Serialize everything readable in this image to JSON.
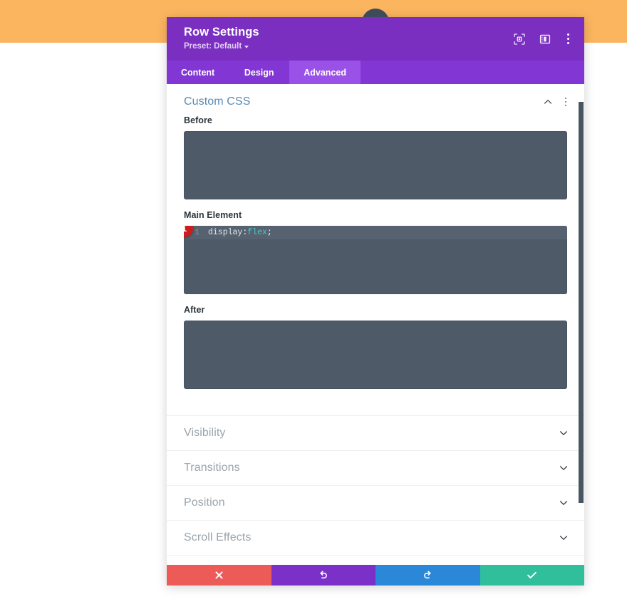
{
  "page": {
    "background_band_color": "#fbb55f",
    "background_color": "#ffffff"
  },
  "modal": {
    "title": "Row Settings",
    "preset_label": "Preset: Default",
    "header_color": "#7a2fc1",
    "tabbar_color": "#8236d4",
    "active_tab_color": "#9a51e8",
    "icons": {
      "focus": "target-focus-icon",
      "layout": "layout-panel-icon",
      "more": "kebab-menu-icon"
    },
    "tabs": [
      {
        "label": "Content",
        "active": false
      },
      {
        "label": "Design",
        "active": false
      },
      {
        "label": "Advanced",
        "active": true
      }
    ]
  },
  "custom_css": {
    "section_title": "Custom CSS",
    "expanded": true,
    "fields": [
      {
        "label": "Before",
        "value": "",
        "lines": []
      },
      {
        "label": "Main Element",
        "value": "display: flex;",
        "lines": [
          {
            "number": "1",
            "tokens": [
              {
                "text": "display",
                "type": "prop"
              },
              {
                "text": ":",
                "type": "punc"
              },
              {
                "text": " flex",
                "type": "value"
              },
              {
                "text": ";",
                "type": "punc"
              }
            ]
          }
        ],
        "marker": "1"
      },
      {
        "label": "After",
        "value": "",
        "lines": []
      }
    ]
  },
  "accordion_sections": [
    {
      "label": "Visibility",
      "expanded": false
    },
    {
      "label": "Transitions",
      "expanded": false
    },
    {
      "label": "Position",
      "expanded": false
    },
    {
      "label": "Scroll Effects",
      "expanded": false
    }
  ],
  "footer_buttons": [
    {
      "name": "cancel",
      "icon": "close-icon",
      "color": "#ec5b58"
    },
    {
      "name": "undo",
      "icon": "undo-icon",
      "color": "#7b31c7"
    },
    {
      "name": "redo",
      "icon": "redo-icon",
      "color": "#2b87d8"
    },
    {
      "name": "save",
      "icon": "check-icon",
      "color": "#31bf9b"
    }
  ],
  "scrollbar": {
    "visible": true,
    "color": "#4a5562"
  }
}
